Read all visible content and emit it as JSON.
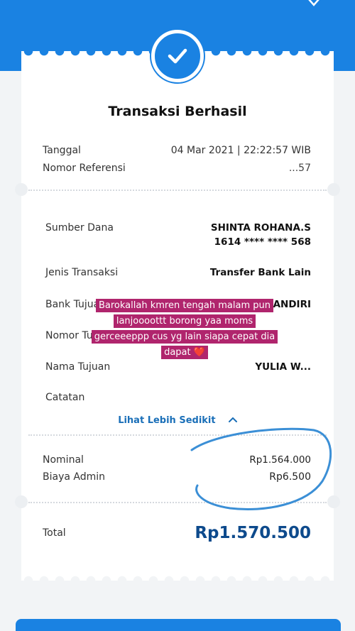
{
  "receipt": {
    "title": "Transaksi Berhasil",
    "tanggal_label": "Tanggal",
    "tanggal_value": "04 Mar 2021 | 22:22:57 WIB",
    "referensi_label": "Nomor Referensi",
    "referensi_value": "...57",
    "sumber_label": "Sumber Dana",
    "sumber_name": "SHINTA ROHANA.S",
    "sumber_account": "1614 **** **** 568",
    "jenis_label": "Jenis Transaksi",
    "jenis_value": "Transfer Bank Lain",
    "bank_label": "Bank Tujuan",
    "bank_value": "BANK MANDIRI",
    "nomor_tujuan_label": "Nomor Tujuan",
    "nama_label": "Nama Tujuan",
    "nama_value": "YULIA W...",
    "catatan_label": "Catatan",
    "lihat_label": "Lihat Lebih Sedikit",
    "nominal_label": "Nominal",
    "nominal_value": "Rp1.564.000",
    "biaya_label": "Biaya Admin",
    "biaya_value": "Rp6.500",
    "total_label": "Total",
    "total_value": "Rp1.570.500"
  },
  "overlay": {
    "story_line1": "Barokallah kmren tengah malam pun",
    "story_line2": "lanjoooottt borong yaa moms",
    "story_line3": "gerceeeppp cus yg lain siapa cepat dia",
    "story_line4": "dapat ❤️"
  },
  "icons": {
    "success": "check-icon",
    "collapse": "chevron-up-icon",
    "top_right": "chevron-down-icon"
  },
  "colors": {
    "primary": "#1a82e2",
    "total": "#0d4a8c",
    "story_bg": "#b0256d",
    "annotation": "#3b8fd6"
  }
}
